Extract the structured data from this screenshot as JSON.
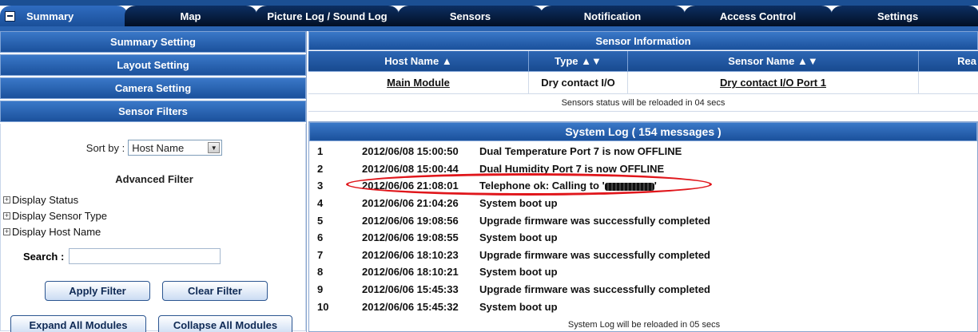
{
  "tabs": [
    {
      "label": "Summary",
      "active": true
    },
    {
      "label": "Map"
    },
    {
      "label": "Picture Log / Sound Log"
    },
    {
      "label": "Sensors"
    },
    {
      "label": "Notification"
    },
    {
      "label": "Access Control"
    },
    {
      "label": "Settings"
    }
  ],
  "left": {
    "sections": {
      "summary_setting": "Summary Setting",
      "layout_setting": "Layout Setting",
      "camera_setting": "Camera Setting",
      "sensor_filters": "Sensor Filters"
    },
    "sort_label": "Sort by :",
    "sort_value": "Host Name",
    "advanced_filter": "Advanced Filter",
    "tree": {
      "display_status": "Display Status",
      "display_sensor_type": "Display Sensor Type",
      "display_host_name": "Display Host Name"
    },
    "search_label": "Search :",
    "search_value": "",
    "apply_filter": "Apply Filter",
    "clear_filter": "Clear Filter",
    "expand_all": "Expand All Modules",
    "collapse_all": "Collapse All Modules"
  },
  "sensor_info": {
    "title": "Sensor Information",
    "columns": {
      "host_name": "Host Name ▲",
      "type": "Type ▲▼",
      "sensor_name": "Sensor Name ▲▼",
      "reading": "Rea"
    },
    "rows": [
      {
        "host": "Main Module",
        "type": "Dry contact I/O",
        "sensor": "Dry contact I/O Port 1"
      }
    ],
    "reload_note": "Sensors status will be reloaded in 04 secs"
  },
  "system_log": {
    "title": "System Log ( 154 messages )",
    "entries": [
      {
        "n": "1",
        "time": "2012/06/08 15:00:50",
        "msg": "Dual Temperature Port 7 is now OFFLINE"
      },
      {
        "n": "2",
        "time": "2012/06/08 15:00:44",
        "msg": "Dual Humidity Port 7 is now OFFLINE"
      },
      {
        "n": "3",
        "time": "2012/06/06 21:08:01",
        "msg": "Telephone ok: Calling to '",
        "redacted": true,
        "msg_end": "'"
      },
      {
        "n": "4",
        "time": "2012/06/06 21:04:26",
        "msg": "System boot up"
      },
      {
        "n": "5",
        "time": "2012/06/06 19:08:56",
        "msg": "Upgrade firmware was successfully completed"
      },
      {
        "n": "6",
        "time": "2012/06/06 19:08:55",
        "msg": "System boot up"
      },
      {
        "n": "7",
        "time": "2012/06/06 18:10:23",
        "msg": "Upgrade firmware was successfully completed"
      },
      {
        "n": "8",
        "time": "2012/06/06 18:10:21",
        "msg": "System boot up"
      },
      {
        "n": "9",
        "time": "2012/06/06 15:45:33",
        "msg": "Upgrade firmware was successfully completed"
      },
      {
        "n": "10",
        "time": "2012/06/06 15:45:32",
        "msg": "System boot up"
      }
    ],
    "reload_note": "System Log will be reloaded in 05 secs"
  },
  "colors": {
    "tab_dark": "#020f24",
    "header_blue": "#1b519c",
    "highlight_red": "#e0161b"
  }
}
